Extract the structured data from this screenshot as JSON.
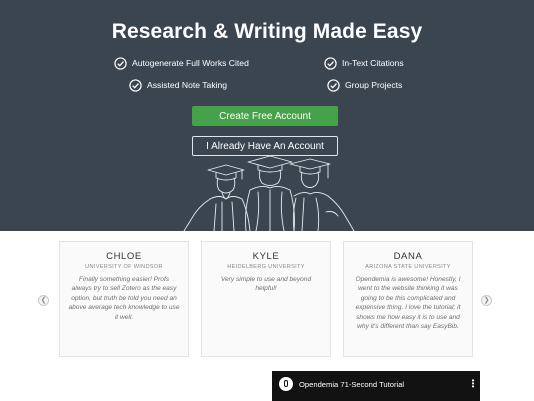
{
  "hero": {
    "title": "Research & Writing Made Easy",
    "features": [
      "Autogenerate Full Works Cited",
      "In-Text Citations",
      "Assisted Note Taking",
      "Group Projects"
    ],
    "cta_primary": "Create Free Account",
    "cta_secondary": "I Already Have An Account",
    "illustration_icon": "graduates-line-art-icon"
  },
  "testimonials": [
    {
      "name": "CHLOE",
      "school": "UNIVERSITY OF WINDSOR",
      "quote": "Finally something easier! Profs always try to sell Zotero as the easy option, but truth be told you need an above average tech knowledge to use it well."
    },
    {
      "name": "KYLE",
      "school": "HEIDELBERG UNIVERSITY",
      "quote": "Very simple to use and beyond helpful!"
    },
    {
      "name": "DANA",
      "school": "ARIZONA STATE UNIVERSITY",
      "quote": "Opendemia is awesome! Honestly, I went to the website thinking it was going to be this complicated and expensive thing. I love the tutorial; it shows me how easy it is to use and why it's different than say EasyBib."
    }
  ],
  "carousel": {
    "prev_icon": "chevron-left-icon",
    "next_icon": "chevron-right-icon"
  },
  "video": {
    "title": "Opendemia 71-Second Tutorial",
    "logo_icon": "opendemia-logo-icon",
    "menu_icon": "more-vert-icon"
  },
  "colors": {
    "hero_bg": "#3a4550",
    "primary_button": "#46a14b",
    "card_bg": "#fafafa"
  }
}
